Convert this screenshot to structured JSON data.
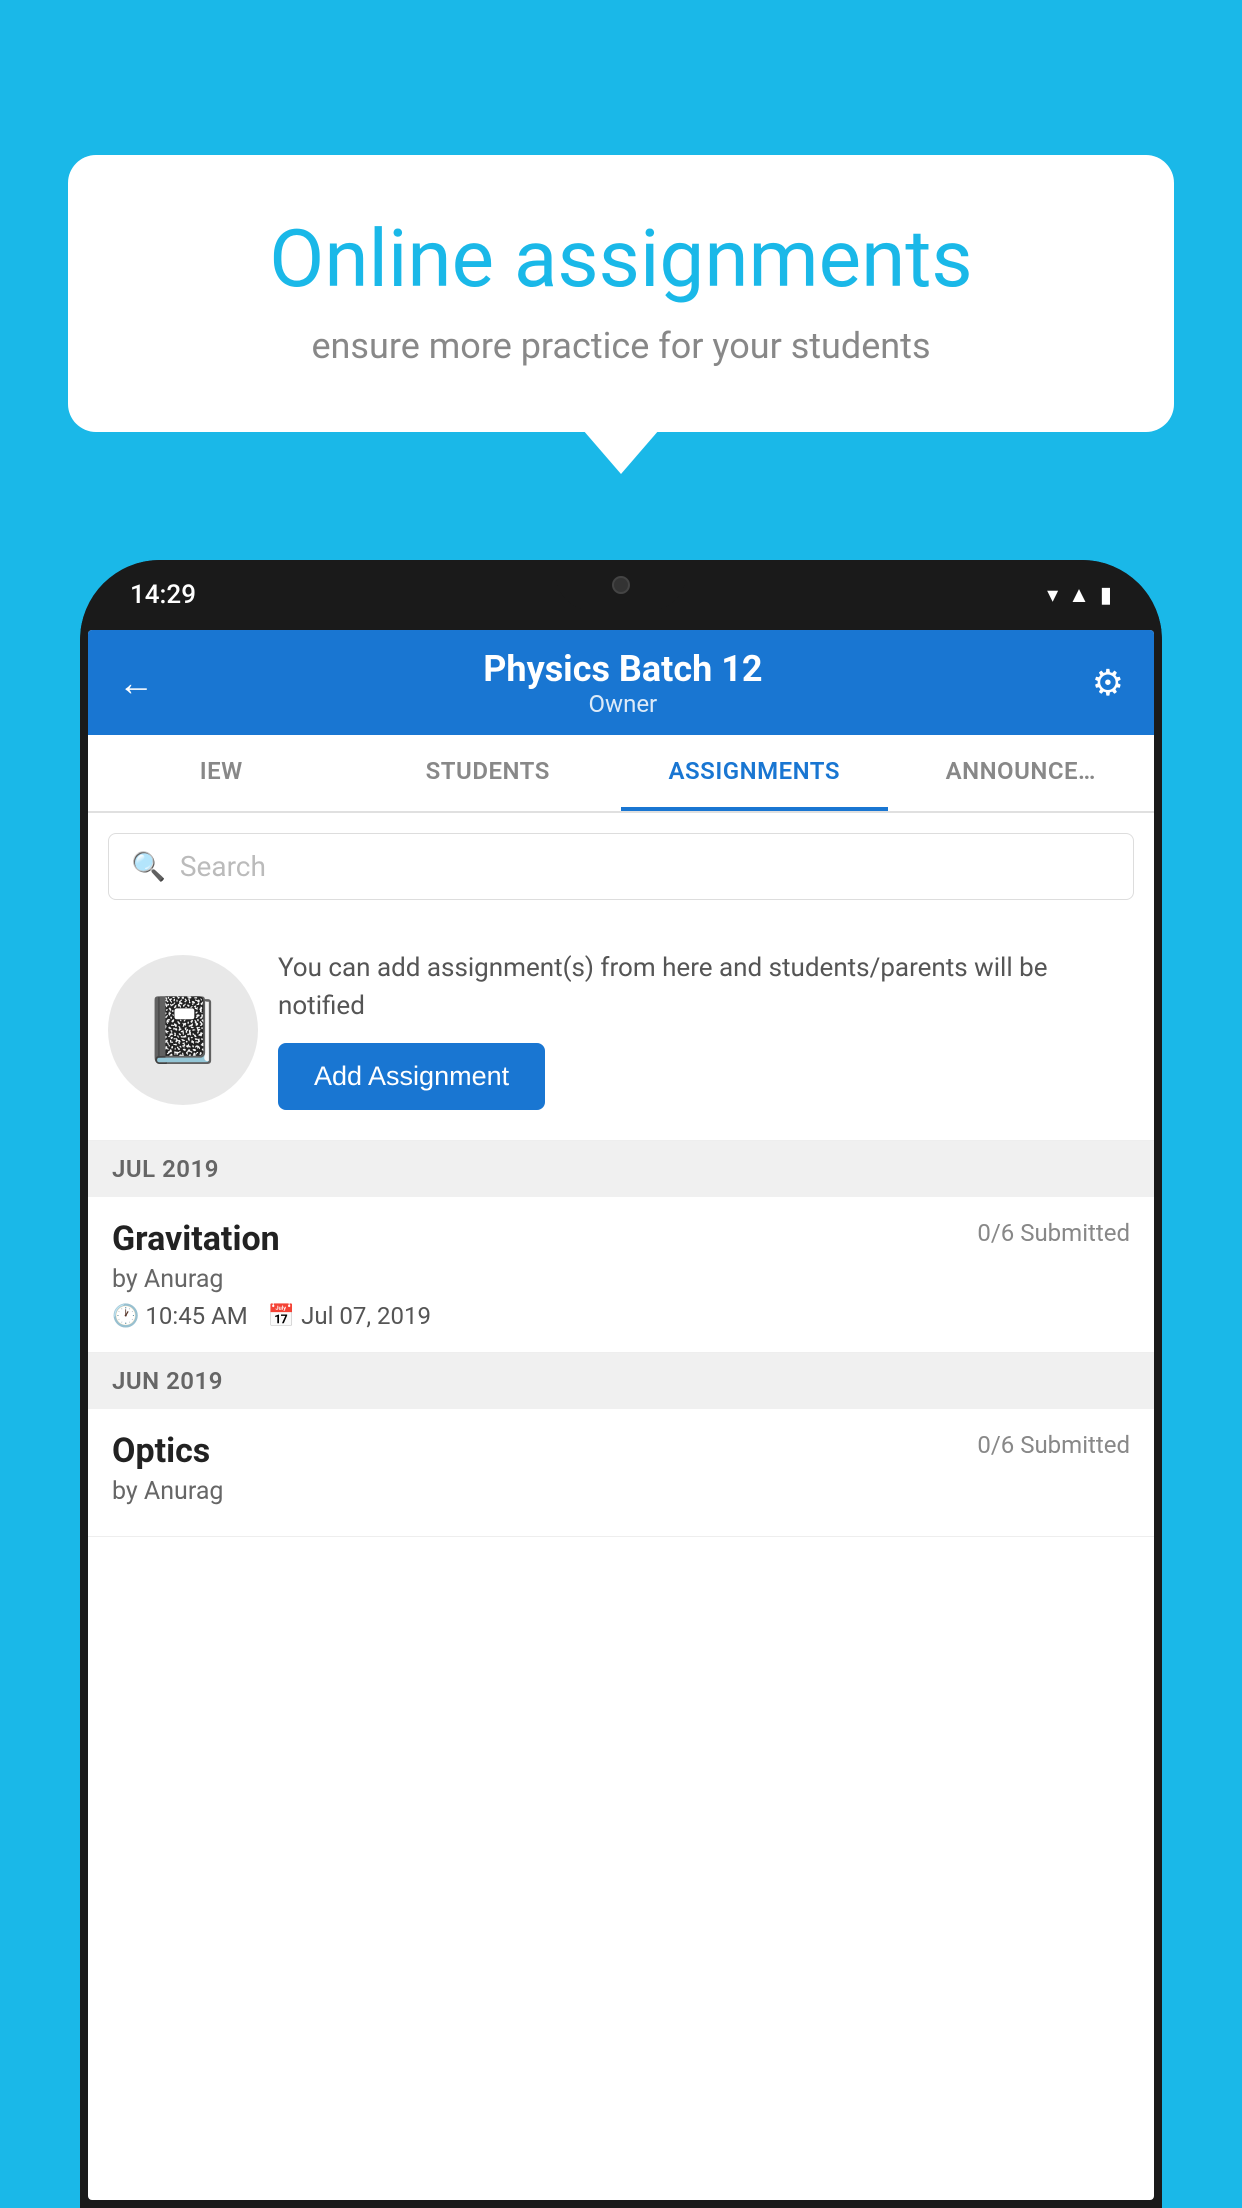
{
  "background_color": "#1AB8E8",
  "speech_bubble": {
    "title": "Online assignments",
    "subtitle": "ensure more practice for your students"
  },
  "phone": {
    "status_bar": {
      "time": "14:29",
      "icons": [
        "wifi",
        "signal",
        "battery"
      ]
    },
    "header": {
      "title": "Physics Batch 12",
      "subtitle": "Owner",
      "back_label": "←",
      "gear_label": "⚙"
    },
    "tabs": [
      {
        "label": "IEW",
        "active": false
      },
      {
        "label": "STUDENTS",
        "active": false
      },
      {
        "label": "ASSIGNMENTS",
        "active": true
      },
      {
        "label": "ANNOUNCEME",
        "active": false
      }
    ],
    "search": {
      "placeholder": "Search"
    },
    "promo": {
      "description": "You can add assignment(s) from here and students/parents will be notified",
      "button_label": "Add Assignment"
    },
    "sections": [
      {
        "label": "JUL 2019",
        "assignments": [
          {
            "name": "Gravitation",
            "submitted": "0/6 Submitted",
            "by": "by Anurag",
            "time": "10:45 AM",
            "date": "Jul 07, 2019"
          }
        ]
      },
      {
        "label": "JUN 2019",
        "assignments": [
          {
            "name": "Optics",
            "submitted": "0/6 Submitted",
            "by": "by Anurag",
            "time": "",
            "date": ""
          }
        ]
      }
    ]
  }
}
